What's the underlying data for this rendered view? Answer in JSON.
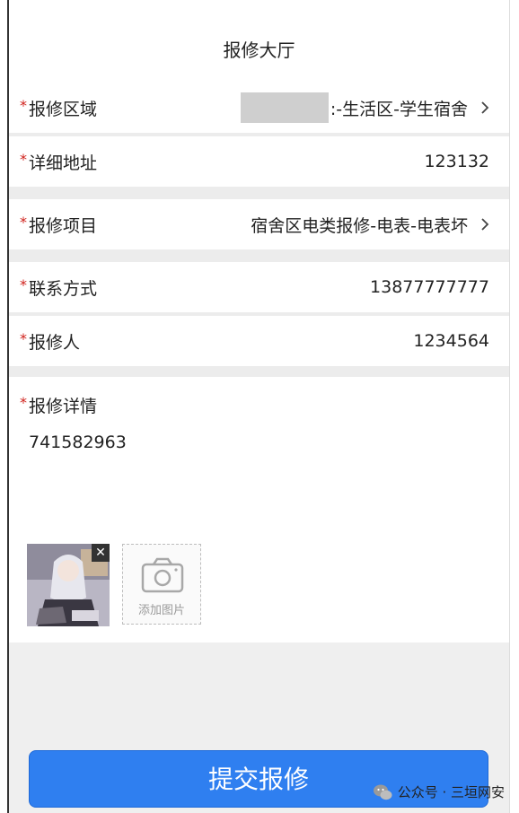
{
  "header": {
    "title": "报修大厅"
  },
  "form": {
    "required_mark": "*",
    "area": {
      "label": "报修区域",
      "value": ":-生活区-学生宿舍"
    },
    "address": {
      "label": "详细地址",
      "value": "123132"
    },
    "item": {
      "label": "报修项目",
      "value": "宿舍区电类报修-电表-电表坏"
    },
    "contact": {
      "label": "联系方式",
      "value": "13877777777"
    },
    "reporter": {
      "label": "报修人",
      "value": "1234564"
    },
    "detail": {
      "label": "报修详情",
      "value": "741582963"
    }
  },
  "images": {
    "remove_label": "✕",
    "add_label": "添加图片"
  },
  "submit_label": "提交报修",
  "watermark": {
    "text": "公众号 · 三垣网安"
  },
  "colors": {
    "accent": "#2f7ff0",
    "required": "#d0201a",
    "background": "#efefef"
  },
  "icons": {
    "arrow": "chevron-right-icon",
    "camera": "camera-icon",
    "wechat": "wechat-icon"
  }
}
